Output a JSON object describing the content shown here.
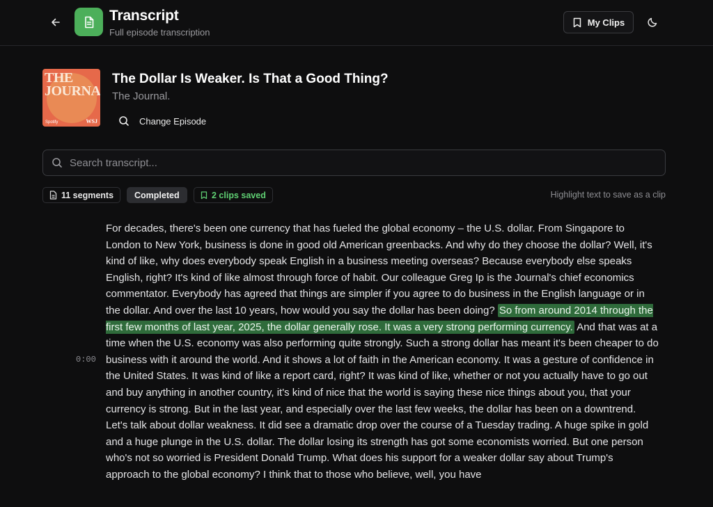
{
  "header": {
    "title": "Transcript",
    "subtitle": "Full episode transcription",
    "my_clips_label": "My Clips"
  },
  "episode": {
    "title": "The Dollar Is Weaker. Is That a Good Thing?",
    "show": "The Journal.",
    "cover_text": "THE JOURNAL.",
    "cover_badge": "Spotify",
    "cover_mark": "WSJ",
    "change_label": "Change Episode"
  },
  "search": {
    "placeholder": "Search transcript..."
  },
  "status": {
    "segments": "11 segments",
    "state": "Completed",
    "clips": "2 clips saved",
    "hint": "Highlight text to save as a clip"
  },
  "segment": {
    "timestamp": "0:00",
    "text_before": "For decades, there's been one currency that has fueled the global economy – the U.S. dollar. From Singapore to London to New York, business is done in good old American greenbacks. And why do they choose the dollar? Well, it's kind of like, why does everybody speak English in a business meeting overseas? Because everybody else speaks English, right? It's kind of like almost through force of habit. Our colleague Greg Ip is the Journal's chief economics commentator. Everybody has agreed that things are simpler if you agree to do business in the English language or in the dollar. And over the last 10 years, how would you say the dollar has been doing? ",
    "highlight": "So from around 2014 through the first few months of last year, 2025, the dollar generally rose. It was a very strong performing currency.",
    "text_after": " And that was at a time when the U.S. economy was also performing quite strongly. Such a strong dollar has meant it's been cheaper to do business with it around the world. And it shows a lot of faith in the American economy. It was a gesture of confidence in the United States. It was kind of like a report card, right? It was kind of like, whether or not you actually have to go out and buy anything in another country, it's kind of nice that the world is saying these nice things about you, that your currency is strong. But in the last year, and especially over the last few weeks, the dollar has been on a downtrend. Let's talk about dollar weakness. It did see a dramatic drop over the course of a Tuesday trading. A huge spike in gold and a huge plunge in the U.S. dollar. The dollar losing its strength has got some economists worried. But one person who's not so worried is President Donald Trump. What does his support for a weaker dollar say about Trump's approach to the global economy? I think that to those who believe, well, you have"
  },
  "colors": {
    "accent": "#4caf5a",
    "clips_green": "#5fcf73",
    "highlight_bg": "#2f6b3b",
    "cover_orange": "#e6694a"
  },
  "icons": {
    "back": "arrow-left-icon",
    "logo": "document-icon",
    "bookmark": "bookmark-icon",
    "theme": "moon-icon",
    "search": "search-icon",
    "segments": "file-icon"
  }
}
